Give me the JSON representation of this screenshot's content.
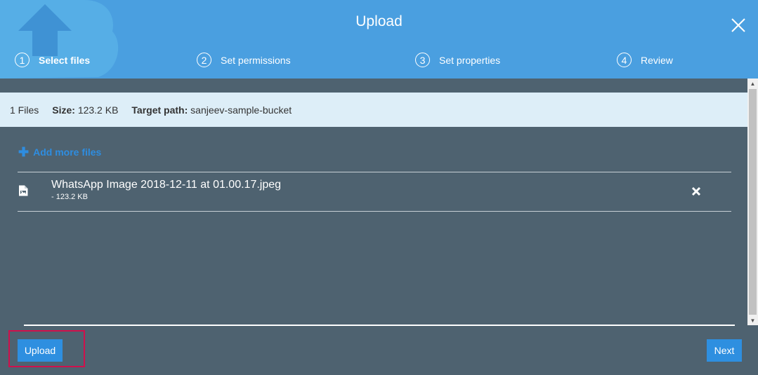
{
  "dialog": {
    "title": "Upload"
  },
  "steps": [
    {
      "number": "1",
      "label": "Select files",
      "active": true
    },
    {
      "number": "2",
      "label": "Set permissions",
      "active": false
    },
    {
      "number": "3",
      "label": "Set properties",
      "active": false
    },
    {
      "number": "4",
      "label": "Review",
      "active": false
    }
  ],
  "info": {
    "files_count": "1 Files",
    "size_label": "Size:",
    "size_value": "123.2 KB",
    "target_label": "Target path:",
    "target_value": "sanjeev-sample-bucket"
  },
  "add_more_label": "Add more files",
  "files": [
    {
      "name": "WhatsApp Image 2018-12-11 at 01.00.17.jpeg",
      "size": "- 123.2 KB"
    }
  ],
  "footer": {
    "upload_label": "Upload",
    "next_label": "Next"
  },
  "icons": {
    "close": "close-icon",
    "file": "image-file-icon",
    "remove": "remove-icon",
    "add": "plus-icon"
  },
  "colors": {
    "header": "#4a9fe0",
    "body": "#4e6270",
    "info_bar": "#ddeef8",
    "button": "#2e8fe0",
    "link": "#2e8de0",
    "highlight": "#d0104c"
  }
}
